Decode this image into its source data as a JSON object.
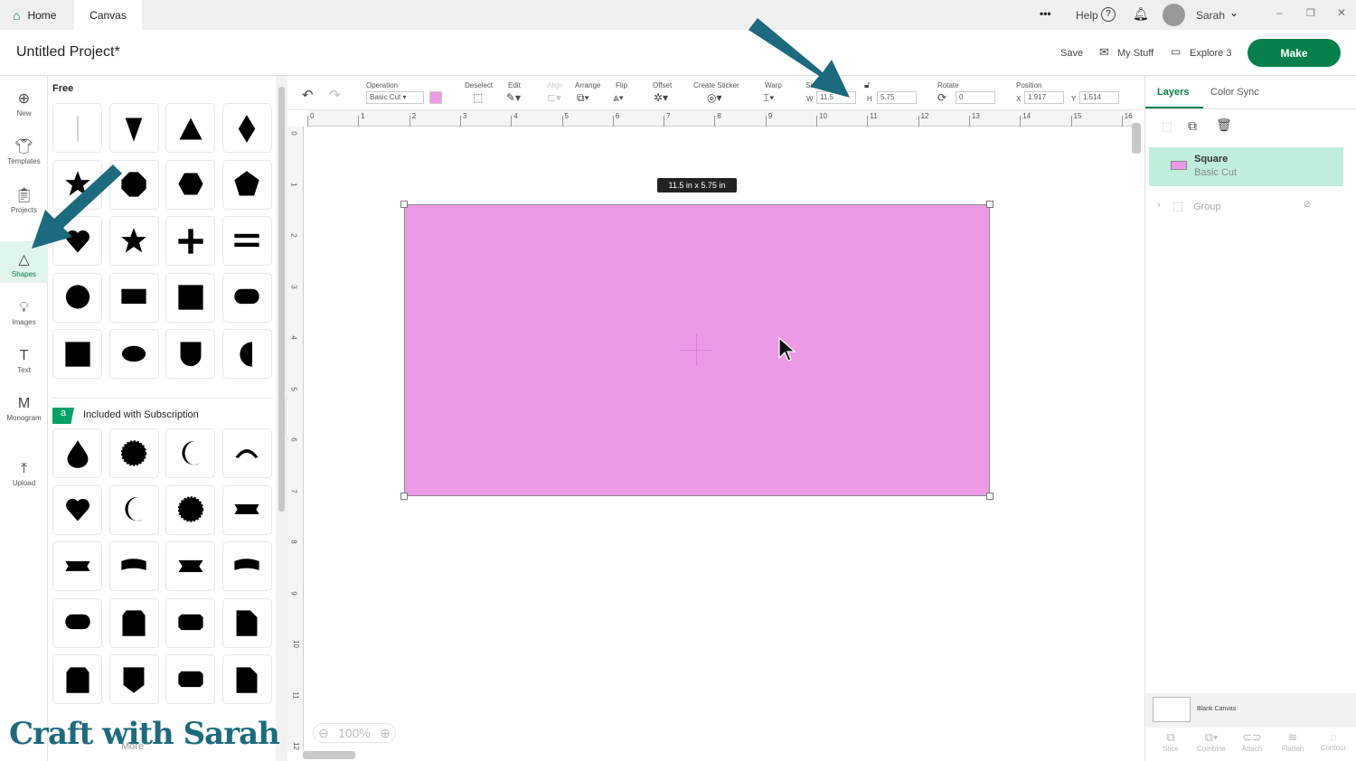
{
  "topbar": {
    "home": "Home",
    "canvas": "Canvas",
    "more": "•••",
    "help": "Help",
    "user": "Sarah"
  },
  "title": {
    "project": "Untitled Project*",
    "save": "Save",
    "my_stuff": "My Stuff",
    "machine": "Explore 3",
    "make": "Make"
  },
  "nav": [
    {
      "label": "New",
      "icon": "plus-icon"
    },
    {
      "label": "Templates",
      "icon": "shirt-icon"
    },
    {
      "label": "Projects",
      "icon": "clipboard-icon"
    },
    {
      "label": "Shapes",
      "icon": "shapes-icon"
    },
    {
      "label": "Images",
      "icon": "bulb-icon"
    },
    {
      "label": "Text",
      "icon": "text-icon"
    },
    {
      "label": "Monogram",
      "icon": "monogram-icon"
    },
    {
      "label": "Upload",
      "icon": "upload-icon"
    }
  ],
  "shapes": {
    "free_label": "Free",
    "subscription_label": "Included with Subscription",
    "more_label": "More",
    "free": [
      "line",
      "triangle-down",
      "triangle",
      "diamond",
      "star",
      "octagon",
      "hexagon",
      "pentagon",
      "heart",
      "star",
      "plus",
      "equals",
      "circle",
      "rectangle",
      "square",
      "rounded-rect",
      "square",
      "oval",
      "shield",
      "half-circle"
    ],
    "sub": [
      "drop",
      "scallop-circle",
      "moon",
      "arc",
      "heart",
      "moon",
      "scallop-circle",
      "banner",
      "banner",
      "wavy-banner",
      "ribbon",
      "wavy-banner",
      "rounded-rect",
      "tag",
      "label",
      "tab",
      "tag",
      "shield-tag",
      "label",
      "tab"
    ]
  },
  "toolbar": {
    "operation_label": "Operation",
    "operation_value": "Basic Cut",
    "deselect": "Deselect",
    "edit": "Edit",
    "align": "Align",
    "arrange": "Arrange",
    "flip": "Flip",
    "offset": "Offset",
    "create_sticker": "Create Sticker",
    "warp": "Warp",
    "size": "Size",
    "w_label": "W",
    "w": "11.5",
    "h_label": "H",
    "h": "5.75",
    "rotate": "Rotate",
    "rotate_value": "0",
    "position": "Position",
    "x_label": "X",
    "x": "1.917",
    "y_label": "Y",
    "y": "1.514",
    "swatch_color": "#ec9ae6"
  },
  "ruler": {
    "h": [
      "0",
      "1",
      "2",
      "3",
      "4",
      "5",
      "6",
      "7",
      "8",
      "9",
      "10",
      "11",
      "12",
      "13",
      "14",
      "15",
      "16"
    ],
    "v": [
      "0",
      "1",
      "2",
      "3",
      "4",
      "5",
      "6",
      "7",
      "8",
      "9",
      "10",
      "11",
      "12"
    ]
  },
  "canvas": {
    "dimension": "11.5  in x 5.75  in",
    "zoom": "100%"
  },
  "right": {
    "tab_layers": "Layers",
    "tab_color_sync": "Color Sync",
    "layer_name": "Square",
    "layer_op": "Basic Cut",
    "group": "Group",
    "blank_canvas": "Blank Canvas",
    "bottom": [
      "Slice",
      "Combine",
      "Attach",
      "Flatten",
      "Contour"
    ]
  },
  "watermark": "Craft with Sarah",
  "colors": {
    "accent": "#05804a",
    "arrow": "#1d6a7e",
    "shape": "#ec9ae6"
  }
}
